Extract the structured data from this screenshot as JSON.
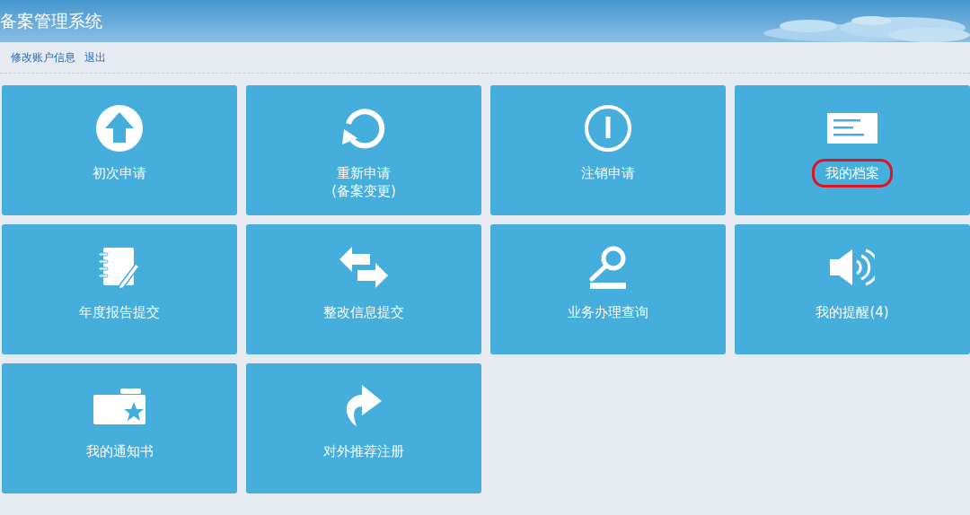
{
  "header": {
    "title": "备案管理系统"
  },
  "nav": {
    "links": [
      "修改账户信息",
      "退出"
    ]
  },
  "tiles": [
    {
      "lines": [
        "初次申请"
      ],
      "highlighted": false
    },
    {
      "lines": [
        "重新申请",
        "(备案变更)"
      ],
      "highlighted": false
    },
    {
      "lines": [
        "注销申请"
      ],
      "highlighted": false
    },
    {
      "lines": [
        "我的档案"
      ],
      "highlighted": true
    },
    {
      "lines": [
        "年度报告提交"
      ],
      "highlighted": false
    },
    {
      "lines": [
        "整改信息提交"
      ],
      "highlighted": false
    },
    {
      "lines": [
        "业务办理查询"
      ],
      "highlighted": false
    },
    {
      "lines": [
        "我的提醒(4)"
      ],
      "highlighted": false
    },
    {
      "lines": [
        "我的通知书"
      ],
      "highlighted": false
    },
    {
      "lines": [
        "对外推荐注册"
      ],
      "highlighted": false
    }
  ]
}
